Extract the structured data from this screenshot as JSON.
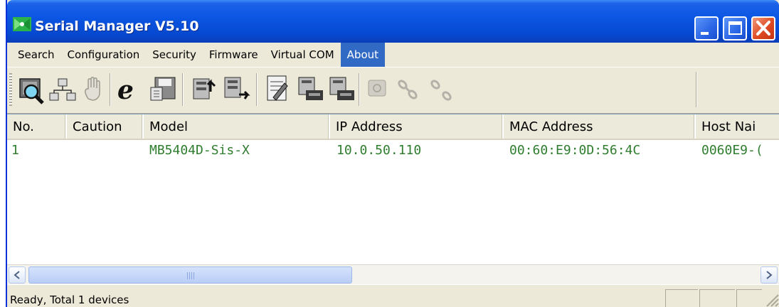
{
  "window": {
    "title": "Serial Manager V5.10"
  },
  "menu": {
    "items": [
      "Search",
      "Configuration",
      "Security",
      "Firmware",
      "Virtual COM",
      "About"
    ],
    "active": "About"
  },
  "toolbar": {
    "buttons": [
      "search-device-icon",
      "network-icon",
      "hand-icon",
      "internet-explorer-icon",
      "save-disk-icon",
      "upload-config-icon",
      "download-config-icon",
      "edit-config-icon",
      "server-icon-1",
      "server-icon-2",
      "phone-icon",
      "link-icon",
      "unlink-icon"
    ]
  },
  "table": {
    "columns": [
      "No.",
      "Caution",
      "Model",
      "IP Address",
      "MAC Address",
      "Host Nai"
    ],
    "rows": [
      {
        "no": "1",
        "caution": "",
        "model": "MB5404D-Sis-X",
        "ip": "10.0.50.110",
        "mac": "00:60:E9:0D:56:4C",
        "host": "0060E9-("
      }
    ]
  },
  "statusbar": {
    "text": "Ready, Total 1 devices"
  },
  "colors": {
    "title_bar": "#0b56e3",
    "menu_highlight": "#316ac5",
    "row_text": "#2f7d2f",
    "close_button": "#de4a23"
  }
}
